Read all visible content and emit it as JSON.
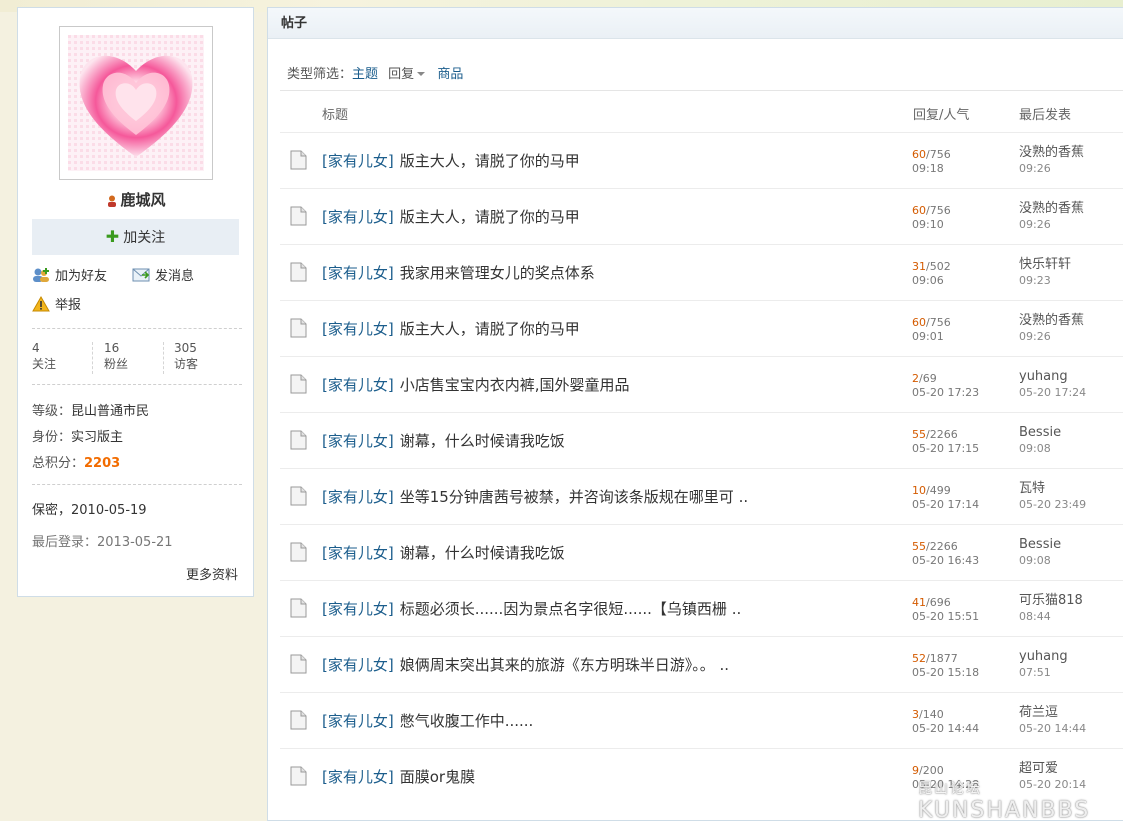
{
  "profile": {
    "username": "鹿城风",
    "follow_label": "加关注",
    "add_friend_label": "加为好友",
    "message_label": "发消息",
    "report_label": "举报",
    "stats": [
      {
        "value": "4",
        "label": "关注"
      },
      {
        "value": "16",
        "label": "粉丝"
      },
      {
        "value": "305",
        "label": "访客"
      }
    ],
    "level_label": "等级：",
    "level_value": "昆山普通市民",
    "role_label": "身份：",
    "role_value": "实习版主",
    "score_label": "总积分：",
    "score_value": "2203",
    "birthday": "保密，2010-05-19",
    "last_login": "最后登录：2013-05-21",
    "more_label": "更多资料"
  },
  "posts": {
    "panel_title": "帖子",
    "filter_label": "类型筛选：",
    "filter_active": "主题",
    "filter_reply": "回复",
    "filter_goods": "商品",
    "col_title": "标题",
    "col_reply_views": "回复/人气",
    "col_last": "最后发表",
    "rows": [
      {
        "tag": "[家有儿女]",
        "title": "版主大人，请脱了你的马甲",
        "replies": "60",
        "views": "/756",
        "time": "09:18",
        "last_user": "没熟的香蕉",
        "last_time": "09:26"
      },
      {
        "tag": "[家有儿女]",
        "title": "版主大人，请脱了你的马甲",
        "replies": "60",
        "views": "/756",
        "time": "09:10",
        "last_user": "没熟的香蕉",
        "last_time": "09:26"
      },
      {
        "tag": "[家有儿女]",
        "title": "我家用来管理女儿的奖点体系",
        "replies": "31",
        "views": "/502",
        "time": "09:06",
        "last_user": "快乐轩轩",
        "last_time": "09:23"
      },
      {
        "tag": "[家有儿女]",
        "title": "版主大人，请脱了你的马甲",
        "replies": "60",
        "views": "/756",
        "time": "09:01",
        "last_user": "没熟的香蕉",
        "last_time": "09:26"
      },
      {
        "tag": "[家有儿女]",
        "title": "小店售宝宝内衣内裤,国外婴童用品",
        "replies": "2",
        "views": "/69",
        "time": "05-20 17:23",
        "last_user": "yuhang",
        "last_time": "05-20 17:24"
      },
      {
        "tag": "[家有儿女]",
        "title": "谢幕，什么时候请我吃饭",
        "replies": "55",
        "views": "/2266",
        "time": "05-20 17:15",
        "last_user": "Bessie",
        "last_time": "09:08"
      },
      {
        "tag": "[家有儿女]",
        "title": "坐等15分钟唐茜号被禁，并咨询该条版规在哪里可 ..",
        "replies": "10",
        "views": "/499",
        "time": "05-20 17:14",
        "last_user": "瓦特",
        "last_time": "05-20 23:49"
      },
      {
        "tag": "[家有儿女]",
        "title": "谢幕，什么时候请我吃饭",
        "replies": "55",
        "views": "/2266",
        "time": "05-20 16:43",
        "last_user": "Bessie",
        "last_time": "09:08"
      },
      {
        "tag": "[家有儿女]",
        "title": "标题必须长......因为景点名字很短......【乌镇西栅 ..",
        "replies": "41",
        "views": "/696",
        "time": "05-20 15:51",
        "last_user": "可乐猫818",
        "last_time": "08:44"
      },
      {
        "tag": "[家有儿女]",
        "title": "娘俩周末突出其来的旅游《东方明珠半日游》。。 ..",
        "replies": "52",
        "views": "/1877",
        "time": "05-20 15:18",
        "last_user": "yuhang",
        "last_time": "07:51"
      },
      {
        "tag": "[家有儿女]",
        "title": "憋气收腹工作中......",
        "replies": "3",
        "views": "/140",
        "time": "05-20 14:44",
        "last_user": "荷兰逗",
        "last_time": "05-20 14:44"
      },
      {
        "tag": "[家有儿女]",
        "title": "面膜or鬼膜",
        "replies": "9",
        "views": "/200",
        "time": "05-20 14:28",
        "last_user": "超可爱",
        "last_time": "05-20 20:14"
      }
    ]
  },
  "watermark": {
    "small": "昆山论坛",
    "large": "KUNSHANBBS"
  }
}
